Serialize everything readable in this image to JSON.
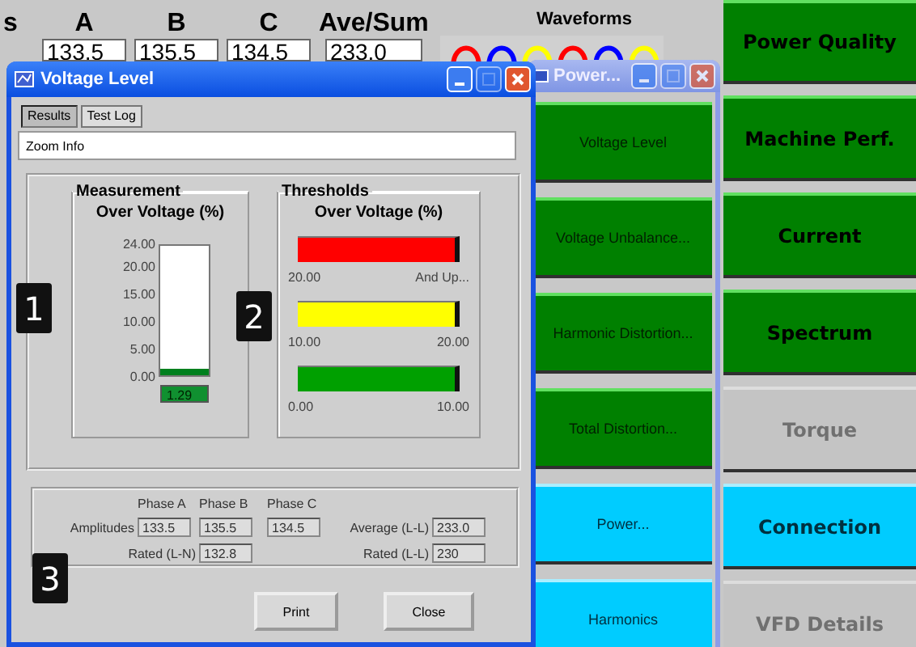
{
  "background_app": {
    "partial_label": "s",
    "columns": [
      {
        "header": "A",
        "value": "133.5"
      },
      {
        "header": "B",
        "value": "135.5"
      },
      {
        "header": "C",
        "value": "134.5"
      },
      {
        "header": "Ave/Sum",
        "value": "233.0"
      }
    ],
    "waveforms": {
      "label": "Waveforms"
    },
    "buttons": [
      {
        "label": "Power Quality",
        "kind": "green"
      },
      {
        "label": "Machine Perf.",
        "kind": "green"
      },
      {
        "label": "Current",
        "kind": "green"
      },
      {
        "label": "Spectrum",
        "kind": "green"
      },
      {
        "label": "Torque",
        "kind": "gray"
      },
      {
        "label": "Connection",
        "kind": "cyan"
      },
      {
        "label": "VFD Details",
        "kind": "gray"
      }
    ]
  },
  "power_window": {
    "title": "Power...",
    "buttons": [
      {
        "label": "Voltage Level",
        "kind": "green"
      },
      {
        "label": "Voltage Unbalance...",
        "kind": "green"
      },
      {
        "label": "Harmonic Distortion...",
        "kind": "green"
      },
      {
        "label": "Total Distortion...",
        "kind": "green"
      },
      {
        "label": "Power...",
        "kind": "cyan"
      },
      {
        "label": "Harmonics",
        "kind": "cyan"
      }
    ]
  },
  "voltage_window": {
    "title": "Voltage Level",
    "tabs": [
      {
        "label": "Results",
        "selected": true
      },
      {
        "label": "Test Log",
        "selected": false
      }
    ],
    "zoom_info": "Zoom Info",
    "measurement": {
      "title": "Measurement",
      "subtitle": "Over Voltage (%)",
      "ticks": [
        "24.00",
        "20.00",
        "15.00",
        "10.00",
        "5.00",
        "0.00"
      ],
      "level": 0.054,
      "reading": "1.29"
    },
    "thresholds": {
      "title": "Thresholds",
      "subtitle": "Over Voltage (%)",
      "bands": [
        {
          "color": "#ff0000",
          "low": "20.00",
          "high": "And Up..."
        },
        {
          "color": "#ffff00",
          "low": "10.00",
          "high": "20.00"
        },
        {
          "color": "#00a000",
          "low": "0.00",
          "high": "10.00"
        }
      ]
    },
    "amplitudes": {
      "phase_headers": [
        "Phase A",
        "Phase B",
        "Phase C"
      ],
      "label": "Amplitudes",
      "values": [
        "133.5",
        "135.5",
        "134.5"
      ],
      "average_label": "Average (L-L)",
      "average": "233.0",
      "rated_ln_label": "Rated (L-N)",
      "rated_ln": "132.8",
      "rated_ll_label": "Rated (L-L)",
      "rated_ll": "230"
    },
    "buttons": [
      "Print",
      "Close"
    ]
  },
  "callouts": [
    "1",
    "2",
    "3"
  ]
}
